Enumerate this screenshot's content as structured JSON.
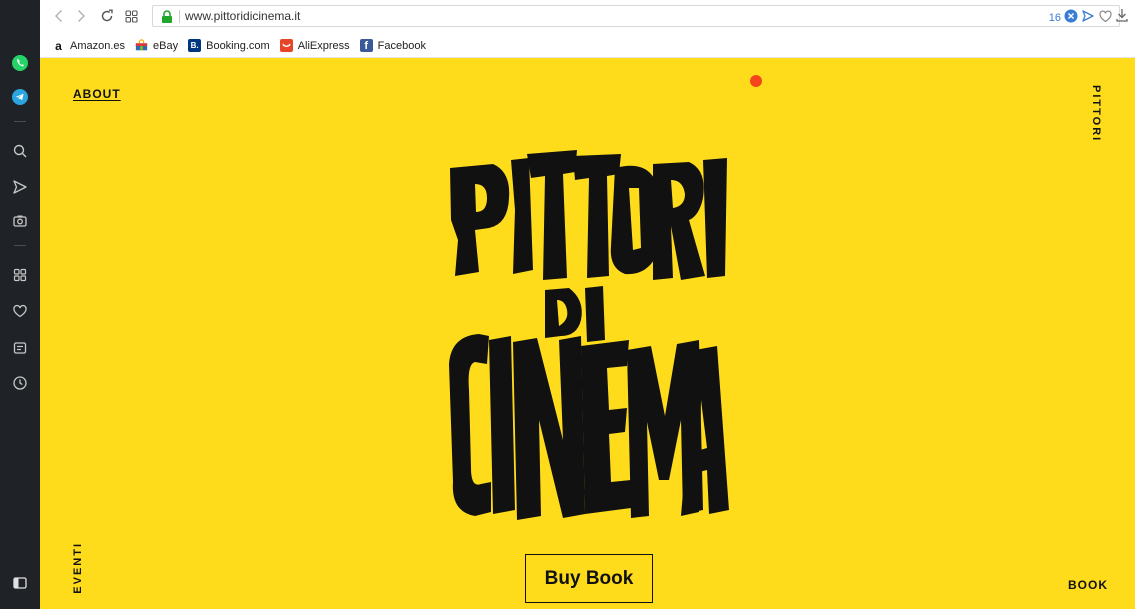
{
  "browser": {
    "url": "www.pittoridicinema.it",
    "badge_count": "16",
    "bookmarks": [
      {
        "label": "Amazon.es",
        "icon": "amazon-icon"
      },
      {
        "label": "eBay",
        "icon": "ebay-icon"
      },
      {
        "label": "Booking.com",
        "icon": "booking-icon",
        "glyph": "B."
      },
      {
        "label": "AliExpress",
        "icon": "aliexpress-icon"
      },
      {
        "label": "Facebook",
        "icon": "facebook-icon",
        "glyph": "f"
      }
    ],
    "sidebar_icons": [
      "whatsapp-icon",
      "telegram-icon",
      "search-icon",
      "send-icon",
      "camera-icon",
      "speed-dial-icon",
      "heart-icon",
      "news-icon",
      "history-icon",
      "panel-toggle-icon"
    ]
  },
  "page": {
    "nav": {
      "about": "ABOUT",
      "pittori": "PITTORI",
      "eventi": "EVENTI",
      "book": "BOOK"
    },
    "logo_text": "PITTORI DI CINEMA",
    "cta": "Buy Book",
    "colors": {
      "background": "#fedc1c",
      "accent_dot": "#f3461b",
      "ink": "#111111"
    }
  }
}
